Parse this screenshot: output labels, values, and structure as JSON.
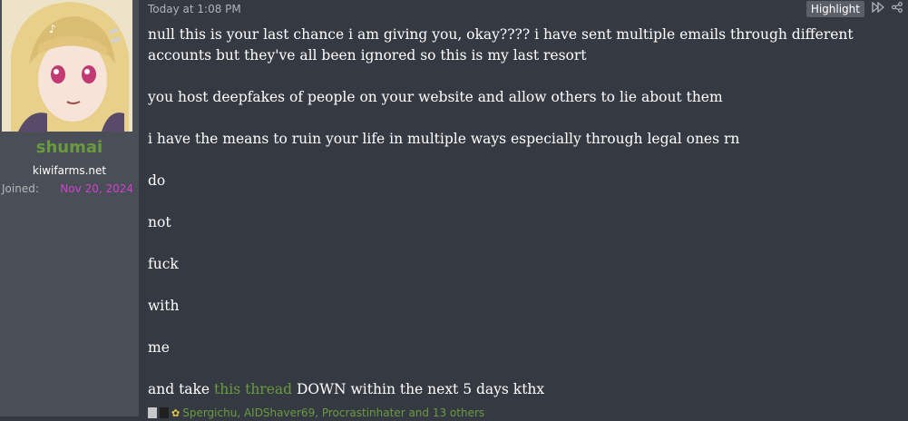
{
  "user": {
    "name": "shumai",
    "title": "kiwifarms.net",
    "joined_label": "Joined:",
    "joined_value": "Nov 20, 2024"
  },
  "post": {
    "timestamp": "Today at 1:08 PM",
    "highlight_label": "Highlight",
    "forward_icon": "fast-forward-icon",
    "share_icon": "share-icon",
    "paragraphs": [
      "null this is your last chance i am giving you, okay???? i have sent multiple emails through different accounts but they've all been ignored so this is my last resort",
      "you host deepfakes of people on your website and allow others to lie about them",
      "i have the means to ruin your life in multiple ways especially through legal ones rn",
      "do",
      "not",
      "fuck",
      "with",
      "me"
    ],
    "last_line": {
      "before": "and take ",
      "link": "this thread",
      "after": " DOWN within the next 5 days kthx"
    }
  },
  "reactions": {
    "text": "Spergichu, AIDShaver69, Procrastinhater and 13 others"
  },
  "colors": {
    "username": "#6a9a3f",
    "joined_date": "#d040d0",
    "link": "#6a9a3f",
    "background": "#353a42",
    "sidebar": "#4a4f57"
  }
}
